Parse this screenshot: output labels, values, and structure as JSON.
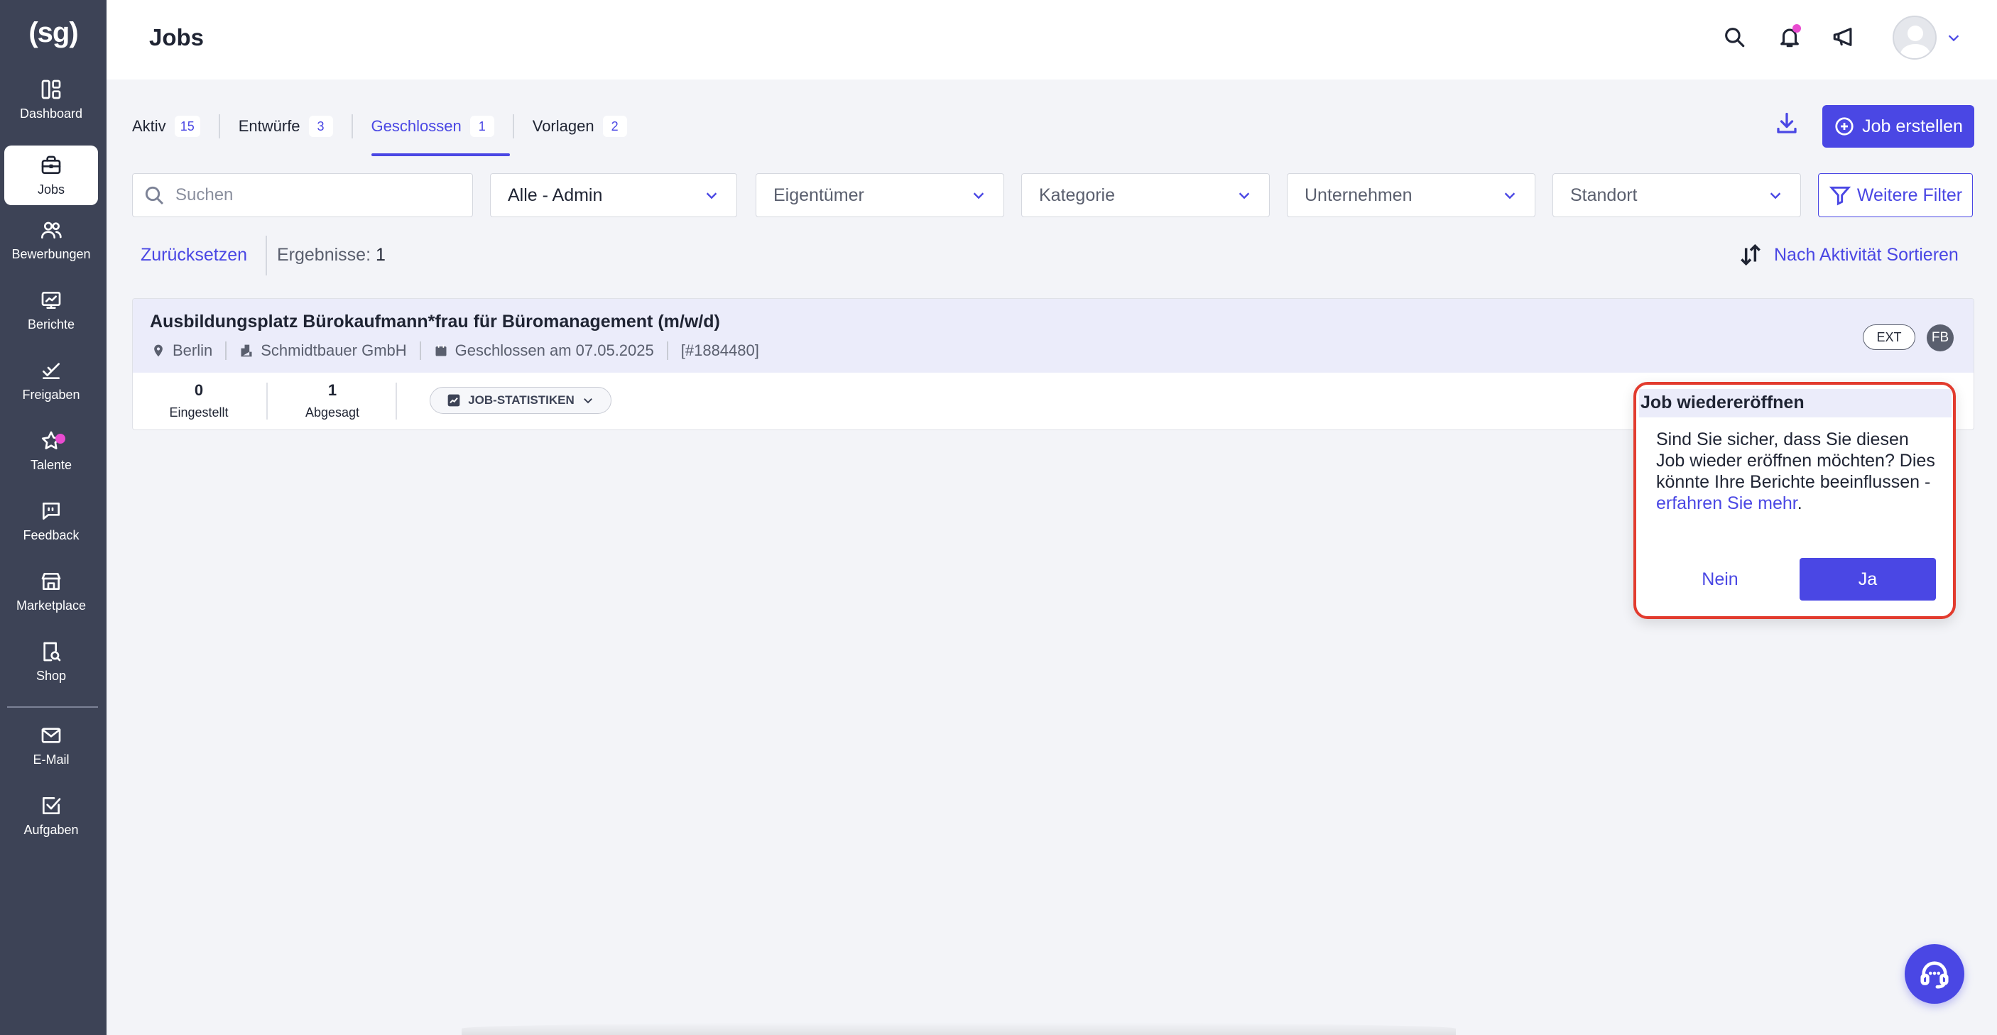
{
  "app": {
    "logo_text": "(sg)"
  },
  "sidebar": {
    "items": [
      {
        "label": "Dashboard",
        "icon": "dashboard-icon"
      },
      {
        "label": "Jobs",
        "icon": "briefcase-icon",
        "active": true
      },
      {
        "label": "Bewerbungen",
        "icon": "users-icon"
      },
      {
        "label": "Berichte",
        "icon": "report-icon"
      },
      {
        "label": "Freigaben",
        "icon": "approval-icon"
      },
      {
        "label": "Talente",
        "icon": "star-icon",
        "dot": true
      },
      {
        "label": "Feedback",
        "icon": "feedback-icon"
      },
      {
        "label": "Marketplace",
        "icon": "store-icon"
      },
      {
        "label": "Shop",
        "icon": "shop-search-icon"
      },
      {
        "label": "E-Mail",
        "icon": "mail-icon"
      },
      {
        "label": "Aufgaben",
        "icon": "checkbox-icon"
      }
    ]
  },
  "header": {
    "title": "Jobs"
  },
  "tabs": [
    {
      "label": "Aktiv",
      "count": "15"
    },
    {
      "label": "Entwürfe",
      "count": "3"
    },
    {
      "label": "Geschlossen",
      "count": "1",
      "active": true
    },
    {
      "label": "Vorlagen",
      "count": "2"
    }
  ],
  "toolbar": {
    "create_label": "Job erstellen"
  },
  "filters": {
    "search_placeholder": "Suchen",
    "admin": "Alle - Admin",
    "owner": "Eigentümer",
    "category": "Kategorie",
    "company": "Unternehmen",
    "location": "Standort",
    "more": "Weitere Filter"
  },
  "results": {
    "reset": "Zurücksetzen",
    "label": "Ergebnisse:",
    "count": "1",
    "sort": "Nach Aktivität Sortieren"
  },
  "job": {
    "title": "Ausbildungsplatz Bürokaufmann*frau für Büromanagement (m/w/d)",
    "location": "Berlin",
    "company": "Schmidtbauer GmbH",
    "closed": "Geschlossen am 07.05.2025",
    "id": "[#1884480]",
    "badge": "EXT",
    "owner_initials": "FB",
    "stats": [
      {
        "num": "0",
        "label": "Eingestellt"
      },
      {
        "num": "1",
        "label": "Abgesagt"
      }
    ],
    "stats_button": "JOB-STATISTIKEN"
  },
  "popover": {
    "title": "Job wiedereröffnen",
    "body": "Sind Sie sicher, dass Sie diesen Job wieder eröffnen möchten? Dies könnte Ihre Berichte beeinflussen - ",
    "link": "erfahren Sie mehr",
    "body_end": ".",
    "no": "Nein",
    "yes": "Ja"
  },
  "colors": {
    "accent": "#4a47e4",
    "sidebar": "#3d4356",
    "highlight": "#e23b2e",
    "notification": "#e94bd0"
  }
}
